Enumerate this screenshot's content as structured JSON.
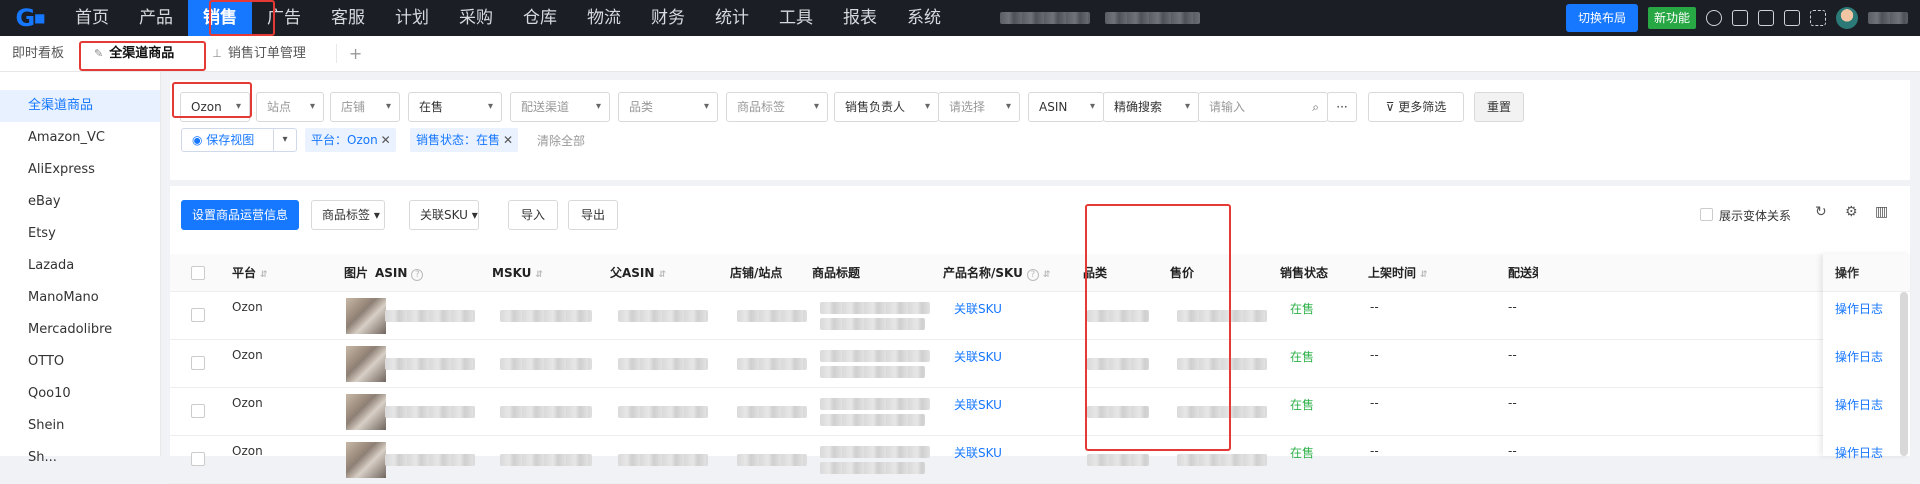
{
  "topbar": {
    "logo": "G",
    "nav": [
      "首页",
      "产品",
      "销售",
      "广告",
      "客服",
      "计划",
      "采购",
      "仓库",
      "物流",
      "财务",
      "统计",
      "工具",
      "报表",
      "系统"
    ],
    "active_nav": "销售",
    "switch_layout": "切换布局",
    "new_feature": "新功能"
  },
  "tabs": {
    "dashboard": "即时看板",
    "active": "全渠道商品",
    "orders": "销售订单管理",
    "add": "+"
  },
  "sidebar": {
    "items": [
      "全渠道商品",
      "Amazon_VC",
      "AliExpress",
      "eBay",
      "Etsy",
      "Lazada",
      "ManoMano",
      "Mercadolibre",
      "OTTO",
      "Qoo10",
      "Shein",
      "Sh..."
    ]
  },
  "filters": {
    "platform": "Ozon",
    "site": "站点",
    "store": "店铺",
    "status": "在售",
    "channel": "配送渠道",
    "category": "品类",
    "tags": "商品标签",
    "owner": "销售负责人",
    "owner_placeholder": "请选择",
    "field": "ASIN",
    "match": "精确搜索",
    "search_placeholder": "请输入",
    "more": "···",
    "more_filters": "更多筛选",
    "reset": "重置",
    "save_view": "保存视图",
    "chip_platform": "平台：Ozon",
    "chip_status": "销售状态：在售",
    "clear_all": "清除全部"
  },
  "toolbar": {
    "set_ops": "设置商品运营信息",
    "tags": "商品标签",
    "link_sku": "关联SKU",
    "import": "导入",
    "export": "导出",
    "show_variants": "展示变体关系"
  },
  "table": {
    "headers": {
      "platform": "平台",
      "image": "图片",
      "asin": "ASIN",
      "msku": "MSKU",
      "parent_asin": "父ASIN",
      "store": "店铺/站点",
      "title": "商品标题",
      "product": "产品名称/SKU",
      "category": "品类",
      "price": "售价",
      "status": "销售状态",
      "listed": "上架时间",
      "ship": "配送渠道",
      "actions": "操作"
    },
    "rows": [
      {
        "platform": "Ozon",
        "product": "关联SKU",
        "status": "在售",
        "listed": "--",
        "ship": "--",
        "action": "操作日志"
      },
      {
        "platform": "Ozon",
        "product": "关联SKU",
        "status": "在售",
        "listed": "--",
        "ship": "--",
        "action": "操作日志"
      },
      {
        "platform": "Ozon",
        "product": "关联SKU",
        "status": "在售",
        "listed": "--",
        "ship": "--",
        "action": "操作日志"
      },
      {
        "platform": "Ozon",
        "product": "关联SKU",
        "status": "在售",
        "listed": "--",
        "ship": "--",
        "action": "操作日志"
      }
    ]
  }
}
